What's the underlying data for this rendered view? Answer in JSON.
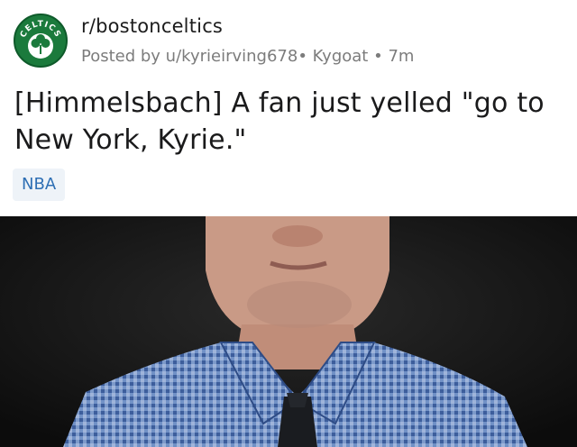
{
  "post": {
    "subreddit": "r/bostonceltics",
    "avatar_icon": "celtics-clover-icon",
    "avatar_text": "CELTICS",
    "posted_by": "Posted by u/kyrieirving678",
    "separator": "•",
    "author_flair": "Kygoat",
    "age": "7m",
    "title": "[Himmelsbach] A fan just yelled \"go to New York, Kyrie.\"",
    "flair": "NBA"
  },
  "colors": {
    "avatar_green": "#1b7a3c",
    "flair_bg": "#eef3f8",
    "flair_text": "#2e6fb4",
    "meta_gray": "#7c7c7c",
    "shirt_blue": "#6f8fc4"
  }
}
